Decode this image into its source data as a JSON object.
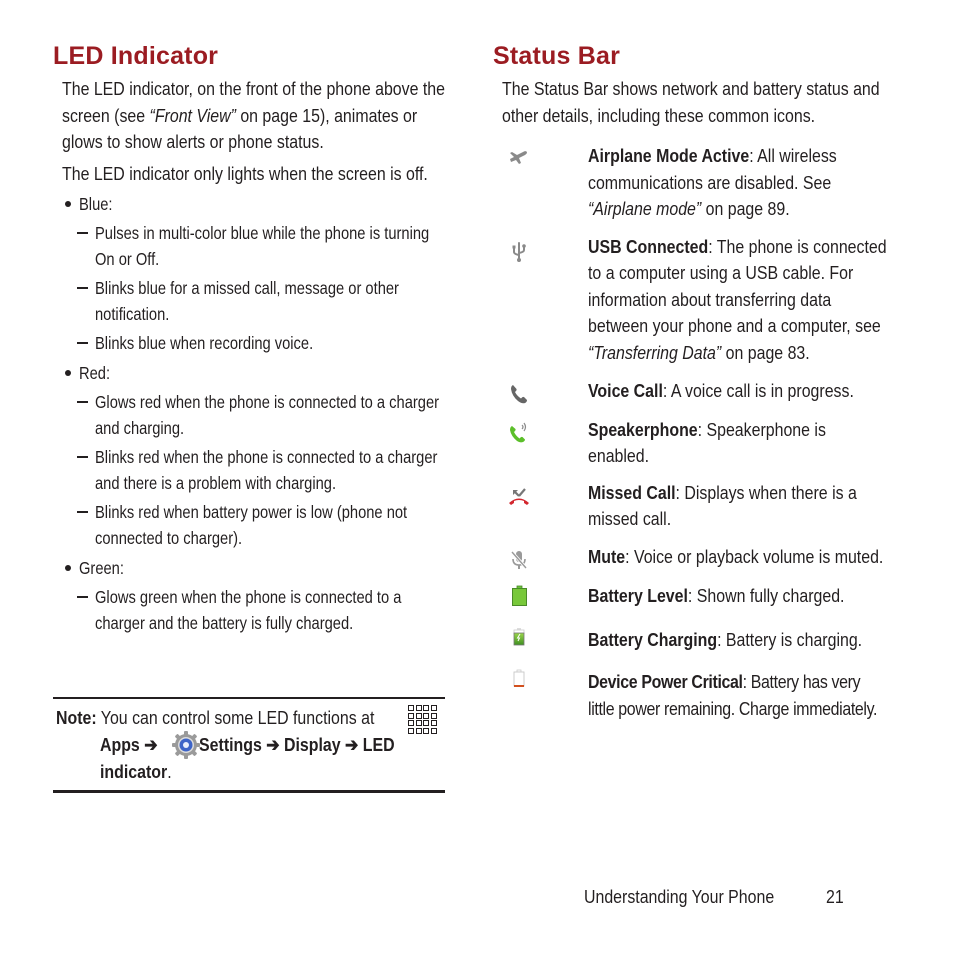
{
  "led": {
    "title": "LED Indicator",
    "intro_1": "The LED indicator, on the front of the phone above the screen (see ",
    "intro_ref": "“Front View”",
    "intro_2": " on page 15), animates or glows to show alerts or phone status.",
    "intro_second": "The LED indicator only lights when the screen is off.",
    "colors": [
      {
        "label": "Blue:",
        "items": [
          "Pulses in multi-color blue while the phone is turning On or Off.",
          "Blinks blue for a missed call, message or other notification.",
          "Blinks blue when recording voice."
        ]
      },
      {
        "label": "Red:",
        "items": [
          "Glows red when the phone is connected to a charger and charging.",
          "Blinks red when the phone is connected to a charger and there is a problem with charging.",
          "Blinks red when battery power is low (phone not connected to charger)."
        ]
      },
      {
        "label": "Green:",
        "items": [
          "Glows green when the phone is connected to a charger and the battery is fully charged."
        ]
      }
    ],
    "note": {
      "label": "Note:",
      "text": "You can control some LED functions at",
      "apps": "Apps",
      "arrow": "➔",
      "settings": "Settings",
      "display": "Display",
      "led": "LED",
      "indicator": "indicator",
      "period": "."
    }
  },
  "status": {
    "title": "Status Bar",
    "intro": "The Status Bar shows network and battery status and other details, including these common icons.",
    "icons": [
      {
        "icon": "airplane-icon",
        "name": "Airplane Mode Active",
        "desc": ": All wireless communications are disabled. See ",
        "ref": "“Airplane mode”",
        "after": " on page 89."
      },
      {
        "icon": "usb-icon",
        "name": "USB Connected",
        "desc": ": The phone is connected to a computer using a USB cable. For information about transferring data between your phone and a computer, see ",
        "ref": "“Transferring Data”",
        "after": " on page 83."
      },
      {
        "icon": "voice-call-icon",
        "name": "Voice Call",
        "desc": ": A voice call is in progress.",
        "ref": "",
        "after": ""
      },
      {
        "icon": "speakerphone-icon",
        "name": "Speakerphone",
        "desc": ": Speakerphone is enabled.",
        "ref": "",
        "after": ""
      },
      {
        "icon": "missed-call-icon",
        "name": "Missed Call",
        "desc": ": Displays when there is a missed call.",
        "ref": "",
        "after": ""
      },
      {
        "icon": "mute-icon",
        "name": "Mute",
        "desc": ": Voice or playback volume is muted.",
        "ref": "",
        "after": ""
      },
      {
        "icon": "battery-full-icon",
        "name": "Battery Level",
        "desc": ": Shown fully charged.",
        "ref": "",
        "after": ""
      },
      {
        "icon": "battery-charging-icon",
        "name": "Battery Charging",
        "desc": ": Battery is charging.",
        "ref": "",
        "after": ""
      },
      {
        "icon": "battery-critical-icon",
        "name": "Device Power Critical",
        "desc": ": Battery has very little power remaining. Charge immediately.",
        "ref": "",
        "after": ""
      }
    ]
  },
  "footer": {
    "section": "Understanding Your Phone",
    "page": "21"
  },
  "colors": {
    "heading": "#9b1c22",
    "text": "#231f20",
    "icon_gray": "#8a8a8a",
    "green": "#6cc33a",
    "red": "#d3272f"
  }
}
